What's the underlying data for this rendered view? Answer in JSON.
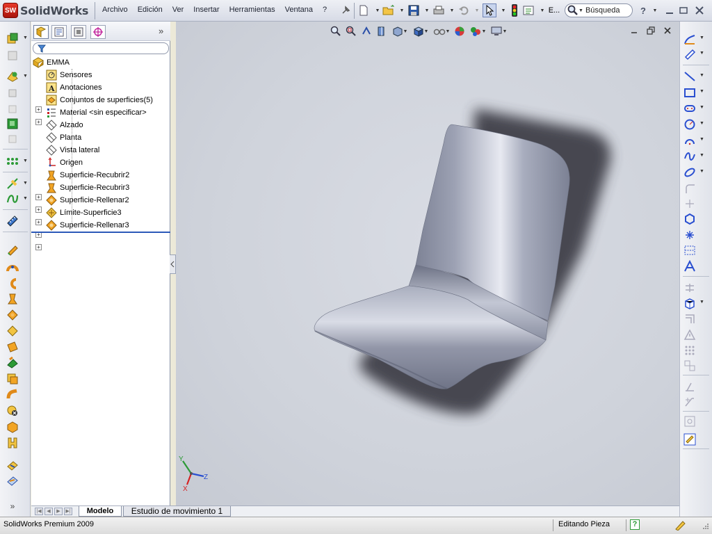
{
  "app": {
    "logo_text": "SolidWorks"
  },
  "menu": {
    "items": [
      "Archivo",
      "Edición",
      "Ver",
      "Insertar",
      "Herramientas",
      "Ventana",
      "?"
    ]
  },
  "toolbar": {
    "overflow_label": "E...",
    "search_label": "Búsqueda",
    "help_label": "?"
  },
  "feature_tree": {
    "root": "EMMA",
    "nodes": [
      {
        "label": "Sensores",
        "icon": "sensor-icon",
        "expandable": false
      },
      {
        "label": "Anotaciones",
        "icon": "annotation-icon",
        "expandable": true
      },
      {
        "label": "Conjuntos de superficies(5)",
        "icon": "surface-bodies-icon",
        "expandable": true
      },
      {
        "label": "Material <sin especificar>",
        "icon": "material-icon",
        "expandable": false
      },
      {
        "label": "Alzado",
        "icon": "plane-icon",
        "expandable": false
      },
      {
        "label": "Planta",
        "icon": "plane-icon",
        "expandable": false
      },
      {
        "label": "Vista lateral",
        "icon": "plane-icon",
        "expandable": false
      },
      {
        "label": "Origen",
        "icon": "origin-icon",
        "expandable": false
      },
      {
        "label": "Superficie-Recubrir2",
        "icon": "loft-surface-icon",
        "expandable": true
      },
      {
        "label": "Superficie-Recubrir3",
        "icon": "loft-surface-icon",
        "expandable": true
      },
      {
        "label": "Superficie-Rellenar2",
        "icon": "fill-surface-icon",
        "expandable": true
      },
      {
        "label": "Límite-Superficie3",
        "icon": "boundary-surface-icon",
        "expandable": true
      },
      {
        "label": "Superficie-Rellenar3",
        "icon": "fill-surface-icon",
        "expandable": true
      }
    ]
  },
  "bottom_tabs": {
    "model": "Modelo",
    "motion": "Estudio de movimiento 1"
  },
  "triad": {
    "x": "X",
    "y": "Y",
    "z": "Z"
  },
  "statusbar": {
    "product": "SolidWorks Premium 2009",
    "mode": "Editando Pieza",
    "help": "?"
  },
  "colors": {
    "accent": "#2b59b8",
    "brand_red": "#c8201a",
    "viewport_bg": "#d2d5dd"
  }
}
